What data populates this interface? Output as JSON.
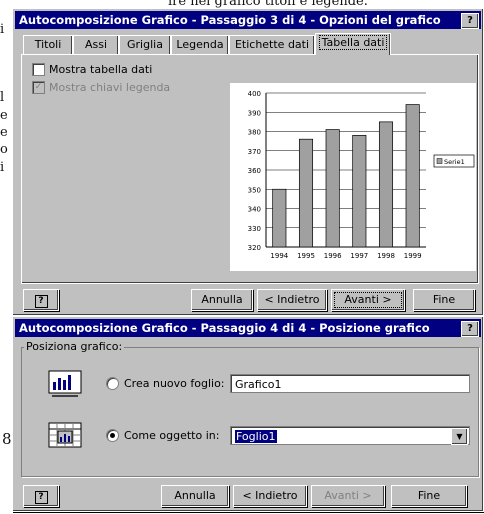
{
  "background": {
    "top_line": "ire nel grafico titoli e legende.",
    "left_chars": [
      "i",
      "l",
      "e",
      "e",
      "o",
      "i"
    ],
    "page_num": "8"
  },
  "dialog1": {
    "title": "Autocomposizione Grafico - Passaggio 3 di 4 - Opzioni del grafico",
    "help": "?",
    "tabs": [
      "Titoli",
      "Assi",
      "Griglia",
      "Legenda",
      "Etichette dati",
      "Tabella dati"
    ],
    "active_tab": "Tabella dati",
    "checkbox_show_table": "Mostra tabella dati",
    "checkbox_show_keys": "Mostra chiavi legenda",
    "buttons": {
      "cancel": "Annulla",
      "back": "< Indietro",
      "next": "Avanti >",
      "finish": "Fine"
    }
  },
  "dialog2": {
    "title": "Autocomposizione Grafico - Passaggio 4 di 4 - Posizione grafico",
    "help": "?",
    "group_label": "Posiziona grafico:",
    "radio_new_sheet": "Crea nuovo foglio:",
    "new_sheet_value": "Grafico1",
    "radio_as_object": "Come oggetto in:",
    "object_value": "Foglio1",
    "buttons": {
      "cancel": "Annulla",
      "back": "< Indietro",
      "next": "Avanti >",
      "finish": "Fine"
    }
  },
  "chart_data": {
    "type": "bar",
    "categories": [
      "1994",
      "1995",
      "1996",
      "1997",
      "1998",
      "1999"
    ],
    "series": [
      {
        "name": "Serie1",
        "values": [
          350,
          376,
          381,
          378,
          385,
          394
        ]
      }
    ],
    "ylim": [
      320,
      400
    ],
    "yticks": [
      "320",
      "330",
      "340",
      "350",
      "360",
      "370",
      "380",
      "390",
      "400"
    ],
    "grid": true,
    "legend": "right",
    "bar_color": "#a0a0a0"
  }
}
